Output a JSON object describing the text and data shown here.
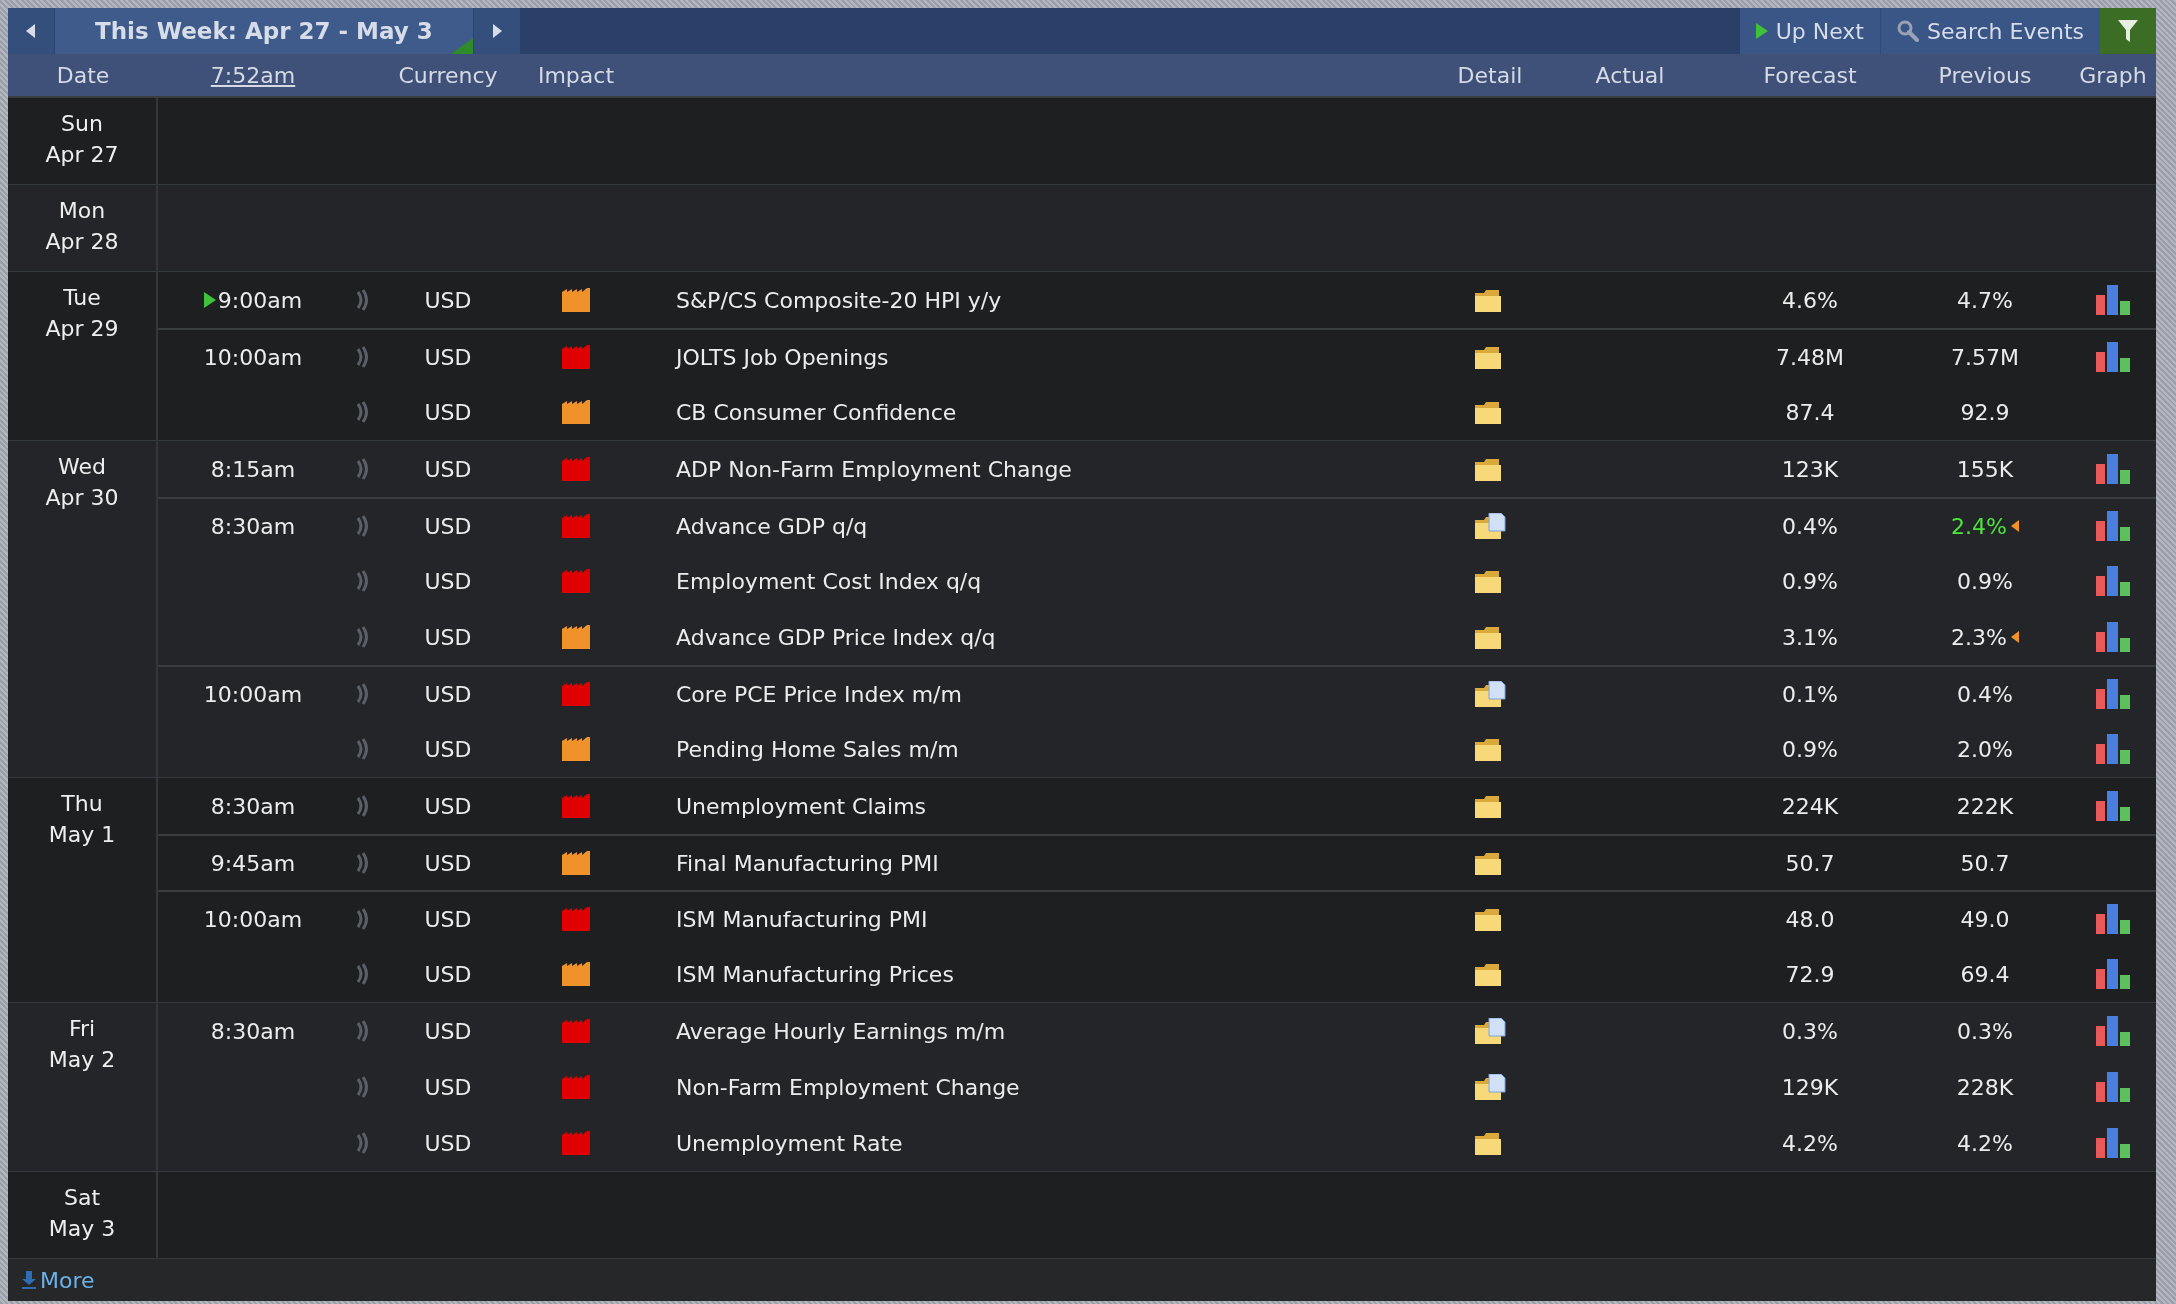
{
  "toolbar": {
    "week_label": "This Week: Apr 27 - May 3",
    "up_next": "Up Next",
    "search": "Search Events"
  },
  "columns": {
    "date": "Date",
    "time": "7:52am",
    "currency": "Currency",
    "impact": "Impact",
    "detail": "Detail",
    "actual": "Actual",
    "forecast": "Forecast",
    "previous": "Previous",
    "graph": "Graph"
  },
  "days": [
    {
      "weekday": "Sun",
      "date": "Apr 27"
    },
    {
      "weekday": "Mon",
      "date": "Apr 28"
    },
    {
      "weekday": "Tue",
      "date": "Apr 29",
      "events": [
        {
          "time": "9:00am",
          "up_next": true,
          "currency": "USD",
          "color": "#f0922a",
          "title": "S&P/CS Composite-20 HPI y/y",
          "has_document": false,
          "forecast": "4.6%",
          "previous": "4.7%",
          "revised": false,
          "better": false,
          "graph": true
        },
        {
          "time": "10:00am",
          "up_next": false,
          "currency": "USD",
          "color": "#e00000",
          "title": "JOLTS Job Openings",
          "has_document": false,
          "forecast": "7.48M",
          "previous": "7.57M",
          "revised": false,
          "better": false,
          "graph": true
        },
        {
          "up_next": false,
          "currency": "USD",
          "color": "#f0922a",
          "title": "CB Consumer Confidence",
          "has_document": false,
          "forecast": "87.4",
          "previous": "92.9",
          "revised": false,
          "better": false,
          "graph": false
        }
      ]
    },
    {
      "weekday": "Wed",
      "date": "Apr 30",
      "events": [
        {
          "time": "8:15am",
          "up_next": false,
          "currency": "USD",
          "color": "#e00000",
          "title": "ADP Non-Farm Employment Change",
          "has_document": false,
          "forecast": "123K",
          "previous": "155K",
          "revised": false,
          "better": false,
          "graph": true
        },
        {
          "time": "8:30am",
          "up_next": false,
          "currency": "USD",
          "color": "#e00000",
          "title": "Advance GDP q/q",
          "has_document": true,
          "forecast": "0.4%",
          "previous": "2.4%",
          "revised": true,
          "better": true,
          "graph": true
        },
        {
          "up_next": false,
          "currency": "USD",
          "color": "#e00000",
          "title": "Employment Cost Index q/q",
          "has_document": false,
          "forecast": "0.9%",
          "previous": "0.9%",
          "revised": false,
          "better": false,
          "graph": true
        },
        {
          "up_next": false,
          "currency": "USD",
          "color": "#f0922a",
          "title": "Advance GDP Price Index q/q",
          "has_document": false,
          "forecast": "3.1%",
          "previous": "2.3%",
          "revised": true,
          "better": false,
          "graph": true
        },
        {
          "time": "10:00am",
          "up_next": false,
          "currency": "USD",
          "color": "#e00000",
          "title": "Core PCE Price Index m/m",
          "has_document": true,
          "forecast": "0.1%",
          "previous": "0.4%",
          "revised": false,
          "better": false,
          "graph": true
        },
        {
          "up_next": false,
          "currency": "USD",
          "color": "#f0922a",
          "title": "Pending Home Sales m/m",
          "has_document": false,
          "forecast": "0.9%",
          "previous": "2.0%",
          "revised": false,
          "better": false,
          "graph": true
        }
      ]
    },
    {
      "weekday": "Thu",
      "date": "May 1",
      "events": [
        {
          "time": "8:30am",
          "up_next": false,
          "currency": "USD",
          "color": "#e00000",
          "title": "Unemployment Claims",
          "has_document": false,
          "forecast": "224K",
          "previous": "222K",
          "revised": false,
          "better": false,
          "graph": true
        },
        {
          "time": "9:45am",
          "up_next": false,
          "currency": "USD",
          "color": "#f0922a",
          "title": "Final Manufacturing PMI",
          "has_document": false,
          "forecast": "50.7",
          "previous": "50.7",
          "revised": false,
          "better": false,
          "graph": false
        },
        {
          "time": "10:00am",
          "up_next": false,
          "currency": "USD",
          "color": "#e00000",
          "title": "ISM Manufacturing PMI",
          "has_document": false,
          "forecast": "48.0",
          "previous": "49.0",
          "revised": false,
          "better": false,
          "graph": true
        },
        {
          "up_next": false,
          "currency": "USD",
          "color": "#f0922a",
          "title": "ISM Manufacturing Prices",
          "has_document": false,
          "forecast": "72.9",
          "previous": "69.4",
          "revised": false,
          "better": false,
          "graph": true
        }
      ]
    },
    {
      "weekday": "Fri",
      "date": "May 2",
      "events": [
        {
          "time": "8:30am",
          "up_next": false,
          "currency": "USD",
          "color": "#e00000",
          "title": "Average Hourly Earnings m/m",
          "has_document": true,
          "forecast": "0.3%",
          "previous": "0.3%",
          "revised": false,
          "better": false,
          "graph": true
        },
        {
          "up_next": false,
          "currency": "USD",
          "color": "#e00000",
          "title": "Non-Farm Employment Change",
          "has_document": true,
          "forecast": "129K",
          "previous": "228K",
          "revised": false,
          "better": false,
          "graph": true
        },
        {
          "up_next": false,
          "currency": "USD",
          "color": "#e00000",
          "title": "Unemployment Rate",
          "has_document": false,
          "forecast": "4.2%",
          "previous": "4.2%",
          "revised": false,
          "better": false,
          "graph": true
        }
      ]
    },
    {
      "weekday": "Sat",
      "date": "May 3"
    }
  ],
  "more": "More"
}
